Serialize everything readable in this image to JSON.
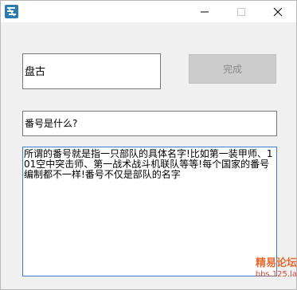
{
  "titlebar": {
    "app_icon": "app-logo-icon",
    "minimize_icon": "minimize-icon",
    "maximize_icon": "maximize-icon",
    "close_icon": "close-icon"
  },
  "form": {
    "name_value": "盘古",
    "done_button_label": "完成",
    "question_value": "番号是什么?",
    "answer_value": "所谓的番号就是指一只部队的具体名字!比如第一装甲师、101空中突击师、第一战术战斗机联队等等!每个国家的番号编制都不一样!番号不仅是部队的名字"
  },
  "watermark": {
    "title": "精易论坛",
    "url": "bbs.125.la"
  },
  "colors": {
    "focus_border": "#3b7ecf",
    "disabled_button": "#cccccc",
    "watermark": "#e86a2e"
  }
}
